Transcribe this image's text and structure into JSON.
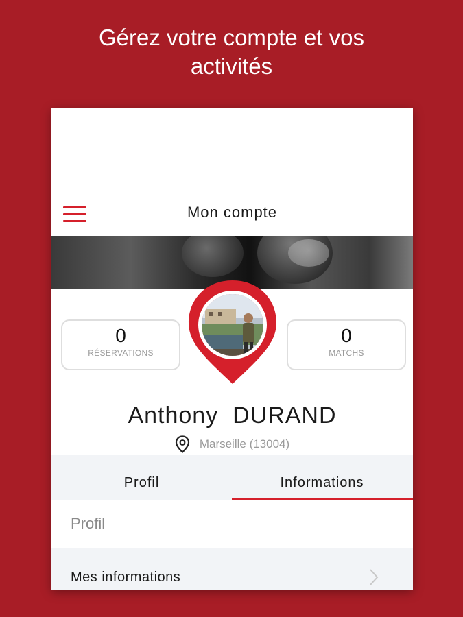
{
  "promo": {
    "headline_line1": "Gérez votre compte et vos",
    "headline_line2": "activités"
  },
  "appbar": {
    "title": "Mon compte",
    "menu_icon": "hamburger-menu-icon"
  },
  "stats": {
    "reservations_count": "0",
    "reservations_label": "RÉSERVATIONS",
    "matchs_count": "0",
    "matchs_label": "MATCHS"
  },
  "profile": {
    "name": "Anthony  DURAND",
    "location": "Marseille (13004)",
    "location_icon": "location-pin-icon"
  },
  "tabs": [
    {
      "label": "Profil",
      "active": false
    },
    {
      "label": "Informations",
      "active": true
    }
  ],
  "section": {
    "header": "Profil",
    "items": [
      {
        "label": "Mes informations",
        "icon": "chevron-right-icon"
      }
    ]
  },
  "colors": {
    "background": "#a81d26",
    "accent": "#d5202b",
    "tab_background": "#f2f4f7"
  }
}
